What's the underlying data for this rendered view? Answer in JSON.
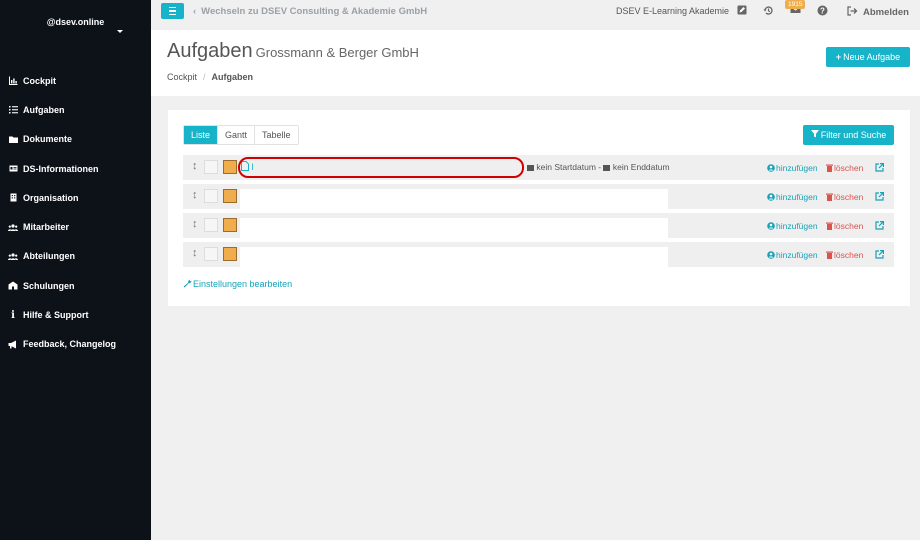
{
  "sidebar": {
    "user": "@dsev.online",
    "items": [
      {
        "label": "Cockpit",
        "icon": "chart-icon"
      },
      {
        "label": "Aufgaben",
        "icon": "list-icon"
      },
      {
        "label": "Dokumente",
        "icon": "folder-icon"
      },
      {
        "label": "DS-Informationen",
        "icon": "id-card-icon"
      },
      {
        "label": "Organisation",
        "icon": "building-icon"
      },
      {
        "label": "Mitarbeiter",
        "icon": "users-icon"
      },
      {
        "label": "Abteilungen",
        "icon": "users-icon"
      },
      {
        "label": "Schulungen",
        "icon": "school-icon"
      },
      {
        "label": "Hilfe & Support",
        "icon": "info-icon"
      },
      {
        "label": "Feedback, Changelog",
        "icon": "megaphone-icon"
      }
    ]
  },
  "topbar": {
    "switch_label": "Wechseln zu DSEV Consulting & Akademie GmbH",
    "academy_label": "DSEV E-Learning Akademie",
    "badge_count": "1915",
    "logout_label": "Abmelden"
  },
  "header": {
    "title": "Aufgaben",
    "subtitle": "Grossmann & Berger GmbH",
    "breadcrumb_home": "Cockpit",
    "breadcrumb_current": "Aufgaben",
    "new_button": "Neue Aufgabe"
  },
  "tasks": {
    "tabs": [
      "Liste",
      "Gantt",
      "Tabelle"
    ],
    "filter_button": "Filter und Suche",
    "rows": [
      {
        "title": "l",
        "start": "kein Startdatum",
        "end": "kein Enddatum"
      },
      {
        "title": "",
        "start": "",
        "end": ""
      },
      {
        "title": "",
        "start": "",
        "end": ""
      },
      {
        "title": "",
        "start": "",
        "end": ""
      }
    ],
    "add_label": "hinzufügen",
    "delete_label": "löschen",
    "settings_link": "Einstellungen bearbeiten"
  },
  "colors": {
    "accent": "#17b3c9",
    "sidebar": "#0d1118",
    "danger": "#d9534f",
    "warning": "#f0ad4e"
  }
}
